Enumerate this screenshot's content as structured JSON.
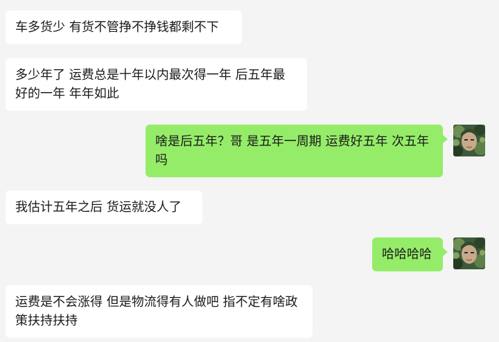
{
  "conversation": {
    "messages": [
      {
        "sender": "other",
        "text": "车多货少 有货不管挣不挣钱都剩不下"
      },
      {
        "sender": "other",
        "text": "多少年了  运费总是十年以内最次得一年  后五年最好的一年   年年如此"
      },
      {
        "sender": "me",
        "text": "啥是后五年？哥 是五年一周期 运费好五年 次五年吗"
      },
      {
        "sender": "other",
        "text": "我估计五年之后 货运就没人了"
      },
      {
        "sender": "me",
        "text": "哈哈哈哈"
      },
      {
        "sender": "other",
        "text": "运费是不会涨得 但是物流得有人做吧 指不定有啥政策扶持扶持"
      }
    ]
  },
  "colors": {
    "background": "#f4f4f4",
    "incoming_bubble": "#ffffff",
    "outgoing_bubble": "#95ec69",
    "text": "#191919"
  },
  "icons": {
    "self_avatar": "camouflage-soldier-avatar-icon"
  }
}
